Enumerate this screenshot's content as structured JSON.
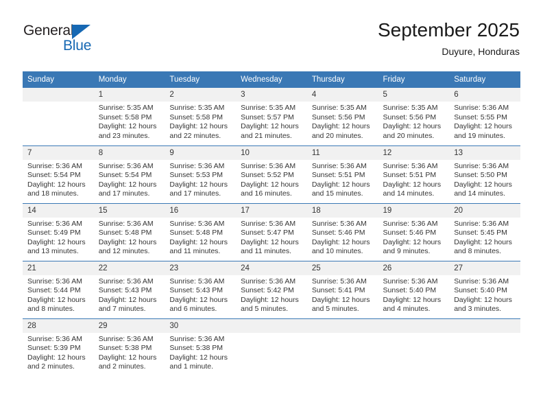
{
  "logo": {
    "word_top": "General",
    "word_bottom": "Blue",
    "triangle_color": "#1668b3",
    "text_color": "#231f20"
  },
  "header": {
    "title": "September 2025",
    "location": "Duyure, Honduras"
  },
  "theme": {
    "header_blue": "#3a78b5",
    "daynum_gray": "#f1f1f1",
    "text_color": "#333333"
  },
  "weekdays": [
    "Sunday",
    "Monday",
    "Tuesday",
    "Wednesday",
    "Thursday",
    "Friday",
    "Saturday"
  ],
  "weeks": [
    [
      {
        "day": "",
        "lines": [
          "",
          "",
          "",
          ""
        ]
      },
      {
        "day": "1",
        "lines": [
          "Sunrise: 5:35 AM",
          "Sunset: 5:58 PM",
          "Daylight: 12 hours",
          "and 23 minutes."
        ]
      },
      {
        "day": "2",
        "lines": [
          "Sunrise: 5:35 AM",
          "Sunset: 5:58 PM",
          "Daylight: 12 hours",
          "and 22 minutes."
        ]
      },
      {
        "day": "3",
        "lines": [
          "Sunrise: 5:35 AM",
          "Sunset: 5:57 PM",
          "Daylight: 12 hours",
          "and 21 minutes."
        ]
      },
      {
        "day": "4",
        "lines": [
          "Sunrise: 5:35 AM",
          "Sunset: 5:56 PM",
          "Daylight: 12 hours",
          "and 20 minutes."
        ]
      },
      {
        "day": "5",
        "lines": [
          "Sunrise: 5:35 AM",
          "Sunset: 5:56 PM",
          "Daylight: 12 hours",
          "and 20 minutes."
        ]
      },
      {
        "day": "6",
        "lines": [
          "Sunrise: 5:36 AM",
          "Sunset: 5:55 PM",
          "Daylight: 12 hours",
          "and 19 minutes."
        ]
      }
    ],
    [
      {
        "day": "7",
        "lines": [
          "Sunrise: 5:36 AM",
          "Sunset: 5:54 PM",
          "Daylight: 12 hours",
          "and 18 minutes."
        ]
      },
      {
        "day": "8",
        "lines": [
          "Sunrise: 5:36 AM",
          "Sunset: 5:54 PM",
          "Daylight: 12 hours",
          "and 17 minutes."
        ]
      },
      {
        "day": "9",
        "lines": [
          "Sunrise: 5:36 AM",
          "Sunset: 5:53 PM",
          "Daylight: 12 hours",
          "and 17 minutes."
        ]
      },
      {
        "day": "10",
        "lines": [
          "Sunrise: 5:36 AM",
          "Sunset: 5:52 PM",
          "Daylight: 12 hours",
          "and 16 minutes."
        ]
      },
      {
        "day": "11",
        "lines": [
          "Sunrise: 5:36 AM",
          "Sunset: 5:51 PM",
          "Daylight: 12 hours",
          "and 15 minutes."
        ]
      },
      {
        "day": "12",
        "lines": [
          "Sunrise: 5:36 AM",
          "Sunset: 5:51 PM",
          "Daylight: 12 hours",
          "and 14 minutes."
        ]
      },
      {
        "day": "13",
        "lines": [
          "Sunrise: 5:36 AM",
          "Sunset: 5:50 PM",
          "Daylight: 12 hours",
          "and 14 minutes."
        ]
      }
    ],
    [
      {
        "day": "14",
        "lines": [
          "Sunrise: 5:36 AM",
          "Sunset: 5:49 PM",
          "Daylight: 12 hours",
          "and 13 minutes."
        ]
      },
      {
        "day": "15",
        "lines": [
          "Sunrise: 5:36 AM",
          "Sunset: 5:48 PM",
          "Daylight: 12 hours",
          "and 12 minutes."
        ]
      },
      {
        "day": "16",
        "lines": [
          "Sunrise: 5:36 AM",
          "Sunset: 5:48 PM",
          "Daylight: 12 hours",
          "and 11 minutes."
        ]
      },
      {
        "day": "17",
        "lines": [
          "Sunrise: 5:36 AM",
          "Sunset: 5:47 PM",
          "Daylight: 12 hours",
          "and 11 minutes."
        ]
      },
      {
        "day": "18",
        "lines": [
          "Sunrise: 5:36 AM",
          "Sunset: 5:46 PM",
          "Daylight: 12 hours",
          "and 10 minutes."
        ]
      },
      {
        "day": "19",
        "lines": [
          "Sunrise: 5:36 AM",
          "Sunset: 5:46 PM",
          "Daylight: 12 hours",
          "and 9 minutes."
        ]
      },
      {
        "day": "20",
        "lines": [
          "Sunrise: 5:36 AM",
          "Sunset: 5:45 PM",
          "Daylight: 12 hours",
          "and 8 minutes."
        ]
      }
    ],
    [
      {
        "day": "21",
        "lines": [
          "Sunrise: 5:36 AM",
          "Sunset: 5:44 PM",
          "Daylight: 12 hours",
          "and 8 minutes."
        ]
      },
      {
        "day": "22",
        "lines": [
          "Sunrise: 5:36 AM",
          "Sunset: 5:43 PM",
          "Daylight: 12 hours",
          "and 7 minutes."
        ]
      },
      {
        "day": "23",
        "lines": [
          "Sunrise: 5:36 AM",
          "Sunset: 5:43 PM",
          "Daylight: 12 hours",
          "and 6 minutes."
        ]
      },
      {
        "day": "24",
        "lines": [
          "Sunrise: 5:36 AM",
          "Sunset: 5:42 PM",
          "Daylight: 12 hours",
          "and 5 minutes."
        ]
      },
      {
        "day": "25",
        "lines": [
          "Sunrise: 5:36 AM",
          "Sunset: 5:41 PM",
          "Daylight: 12 hours",
          "and 5 minutes."
        ]
      },
      {
        "day": "26",
        "lines": [
          "Sunrise: 5:36 AM",
          "Sunset: 5:40 PM",
          "Daylight: 12 hours",
          "and 4 minutes."
        ]
      },
      {
        "day": "27",
        "lines": [
          "Sunrise: 5:36 AM",
          "Sunset: 5:40 PM",
          "Daylight: 12 hours",
          "and 3 minutes."
        ]
      }
    ],
    [
      {
        "day": "28",
        "lines": [
          "Sunrise: 5:36 AM",
          "Sunset: 5:39 PM",
          "Daylight: 12 hours",
          "and 2 minutes."
        ]
      },
      {
        "day": "29",
        "lines": [
          "Sunrise: 5:36 AM",
          "Sunset: 5:38 PM",
          "Daylight: 12 hours",
          "and 2 minutes."
        ]
      },
      {
        "day": "30",
        "lines": [
          "Sunrise: 5:36 AM",
          "Sunset: 5:38 PM",
          "Daylight: 12 hours",
          "and 1 minute."
        ]
      },
      {
        "day": "",
        "lines": [
          "",
          "",
          "",
          ""
        ]
      },
      {
        "day": "",
        "lines": [
          "",
          "",
          "",
          ""
        ]
      },
      {
        "day": "",
        "lines": [
          "",
          "",
          "",
          ""
        ]
      },
      {
        "day": "",
        "lines": [
          "",
          "",
          "",
          ""
        ]
      }
    ]
  ]
}
